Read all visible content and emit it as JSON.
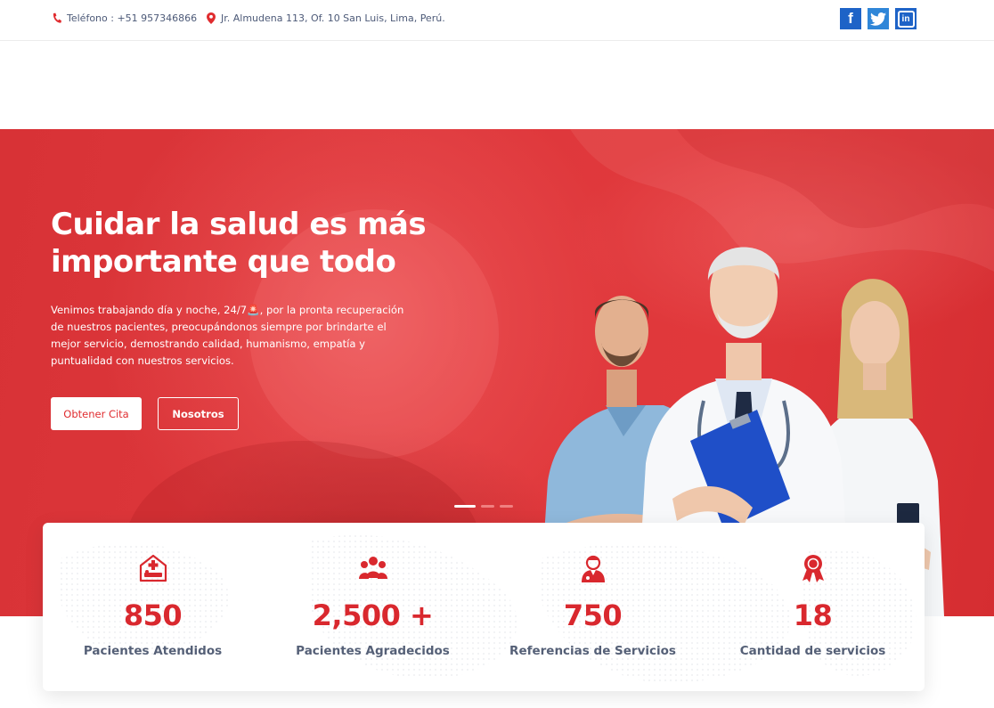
{
  "topbar": {
    "phone": "Teléfono : +51 957346866",
    "address": "Jr. Almudena 113, Of. 10 San Luis, Lima, Perú.",
    "social": [
      {
        "icon": "facebook-icon",
        "glyph": "f"
      },
      {
        "icon": "twitter-icon",
        "glyph": ""
      },
      {
        "icon": "linkedin-icon",
        "glyph": "in"
      }
    ]
  },
  "hero": {
    "title": "Cuidar la salud es más importante que todo",
    "text": "Venimos trabajando día y noche, 24/7🚨, por la pronta recuperación de nuestros pacientes, preocupándonos siempre por brindarte el mejor servicio, demostrando calidad, humanismo, empatía y puntualidad con nuestros servicios.",
    "primary_button": "Obtener Cita",
    "secondary_button": "Nosotros",
    "slides": 3,
    "active_slide": 1
  },
  "stats": [
    {
      "icon": "hospital-bed-icon",
      "value": "850",
      "label": "Pacientes Atendidos"
    },
    {
      "icon": "group-icon",
      "value": "2,500 +",
      "label": "Pacientes Agradecidos"
    },
    {
      "icon": "doctor-icon",
      "value": "750",
      "label": "Referencias de Servicios"
    },
    {
      "icon": "award-ribbon-icon",
      "value": "18",
      "label": "Cantidad de servicios"
    }
  ],
  "colors": {
    "accent": "#d9282e",
    "hero_red": "#de383c",
    "label_text": "#556077",
    "facebook": "#1e63c7",
    "twitter": "#2f86d8"
  }
}
